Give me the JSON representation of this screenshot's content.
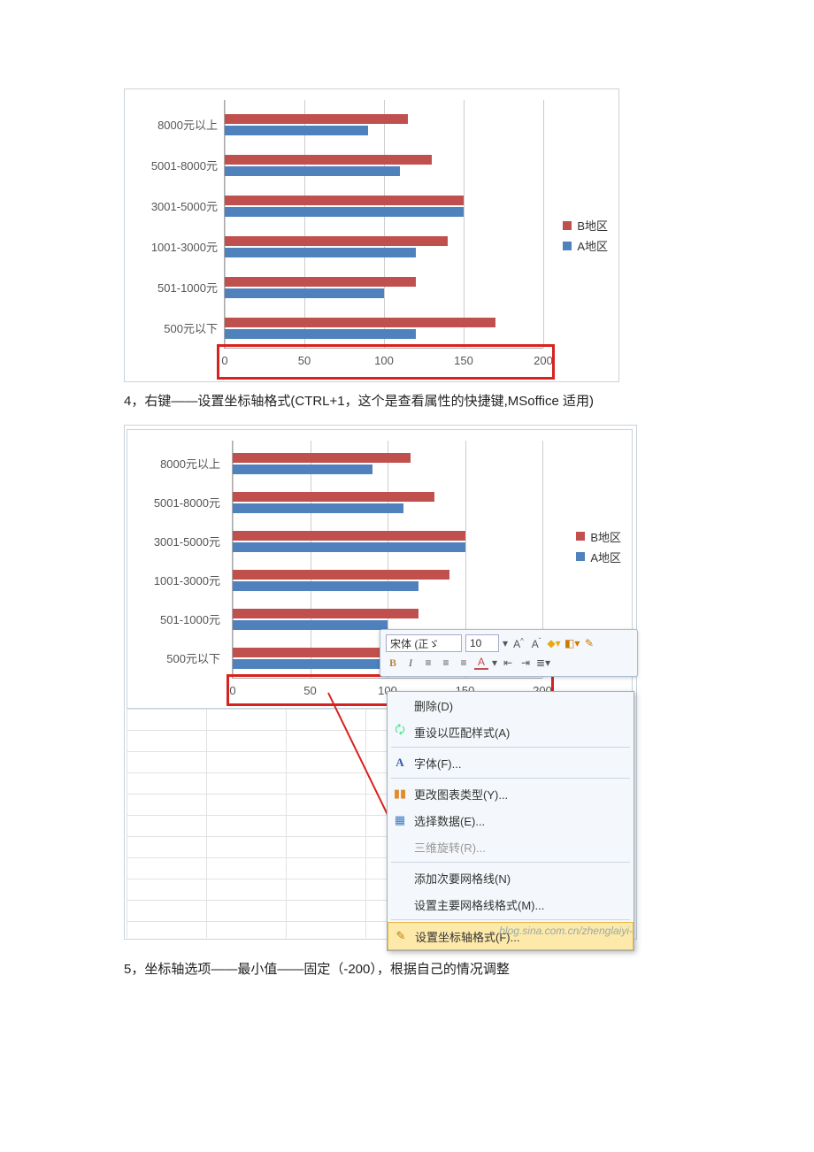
{
  "caption_step4": "4，右键——设置坐标轴格式(CTRL+1，这个是查看属性的快捷键,MSoffice 适用)",
  "caption_step5": "5，坐标轴选项——最小值——固定（-200），根据自己的情况调整",
  "chart_data": [
    {
      "type": "bar",
      "orientation": "horizontal",
      "categories": [
        "500元以下",
        "501-1000元",
        "1001-3000元",
        "3001-5000元",
        "5001-8000元",
        "8000元以上"
      ],
      "series": [
        {
          "name": "B地区",
          "color": "#c0504d",
          "values": [
            170,
            120,
            140,
            150,
            130,
            115
          ]
        },
        {
          "name": "A地区",
          "color": "#4f81bd",
          "values": [
            120,
            100,
            120,
            150,
            110,
            90
          ]
        }
      ],
      "xlim": [
        0,
        210
      ],
      "xticks": [
        0,
        50,
        100,
        150,
        200
      ],
      "title": "",
      "xlabel": "",
      "ylabel": ""
    },
    {
      "type": "bar",
      "orientation": "horizontal",
      "categories": [
        "500元以下",
        "501-1000元",
        "1001-3000元",
        "3001-5000元",
        "5001-8000元",
        "8000元以上"
      ],
      "series": [
        {
          "name": "B地区",
          "color": "#c0504d",
          "values": [
            170,
            120,
            140,
            150,
            130,
            115
          ]
        },
        {
          "name": "A地区",
          "color": "#4f81bd",
          "values": [
            120,
            100,
            120,
            150,
            110,
            90
          ]
        }
      ],
      "xlim": [
        0,
        210
      ],
      "xticks": [
        0,
        50,
        100,
        150,
        200
      ],
      "title": "",
      "xlabel": "",
      "ylabel": ""
    }
  ],
  "legend": {
    "b": "B地区",
    "a": "A地区"
  },
  "mini_toolbar": {
    "font_name": "宋体 (正ゞ",
    "font_size": "10"
  },
  "context_menu": {
    "items": [
      {
        "label": "删除(D)",
        "icon": ""
      },
      {
        "label": "重设以匹配样式(A)",
        "icon": "↺"
      },
      {
        "label": "字体(F)...",
        "icon": "A"
      },
      {
        "label": "更改图表类型(Y)...",
        "icon": "▮"
      },
      {
        "label": "选择数据(E)...",
        "icon": "▦"
      },
      {
        "label": "三维旋转(R)...",
        "icon": "",
        "disabled": true
      },
      {
        "label": "添加次要网格线(N)",
        "icon": ""
      },
      {
        "label": "设置主要网格线格式(M)...",
        "icon": ""
      },
      {
        "label": "设置坐标轴格式(F)...",
        "icon": "✎",
        "highlight": true
      }
    ]
  },
  "watermark": "blog.sina.com.cn/zhenglaiyi-"
}
